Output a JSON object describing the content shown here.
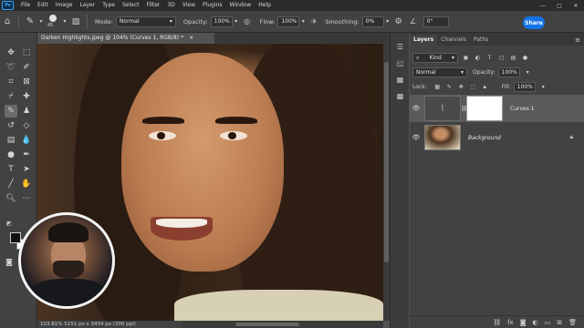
{
  "menubar": {
    "app_logo": "Ps",
    "items": [
      "File",
      "Edit",
      "Image",
      "Layer",
      "Type",
      "Select",
      "Filter",
      "3D",
      "View",
      "Plugins",
      "Window",
      "Help"
    ],
    "window_controls": [
      "—",
      "□",
      "✕"
    ]
  },
  "options_bar": {
    "brush_size": "45",
    "mode_label": "Mode:",
    "mode_value": "Normal",
    "opacity_label": "Opacity:",
    "opacity_value": "100%",
    "flow_label": "Flow:",
    "flow_value": "100%",
    "smoothing_label": "Smoothing:",
    "smoothing_value": "0%",
    "angle_value": "0°",
    "share_label": "Share"
  },
  "document": {
    "tab_title": "Darken Highlights.jpeg @ 104% (Curves 1, RGB/8) *",
    "status": "103.81%   5151 px x 3434 px (300 ppi)"
  },
  "layers_panel": {
    "tabs": [
      "Layers",
      "Channels",
      "Paths"
    ],
    "active_tab": "Layers",
    "filter_value": "Kind",
    "blend_mode": "Normal",
    "opacity_label": "Opacity:",
    "opacity_value": "100%",
    "lock_label": "Lock:",
    "fill_label": "Fill:",
    "fill_value": "100%",
    "layers": [
      {
        "name": "Curves 1",
        "type": "adjustment",
        "selected": true
      },
      {
        "name": "Background",
        "type": "image",
        "locked": true
      }
    ]
  },
  "colors": {
    "accent": "#1473e6",
    "panel_bg": "#424242",
    "menubar_bg": "#2b2b2b",
    "foreground_swatch": "#111111",
    "background_swatch": "#ffffff"
  }
}
